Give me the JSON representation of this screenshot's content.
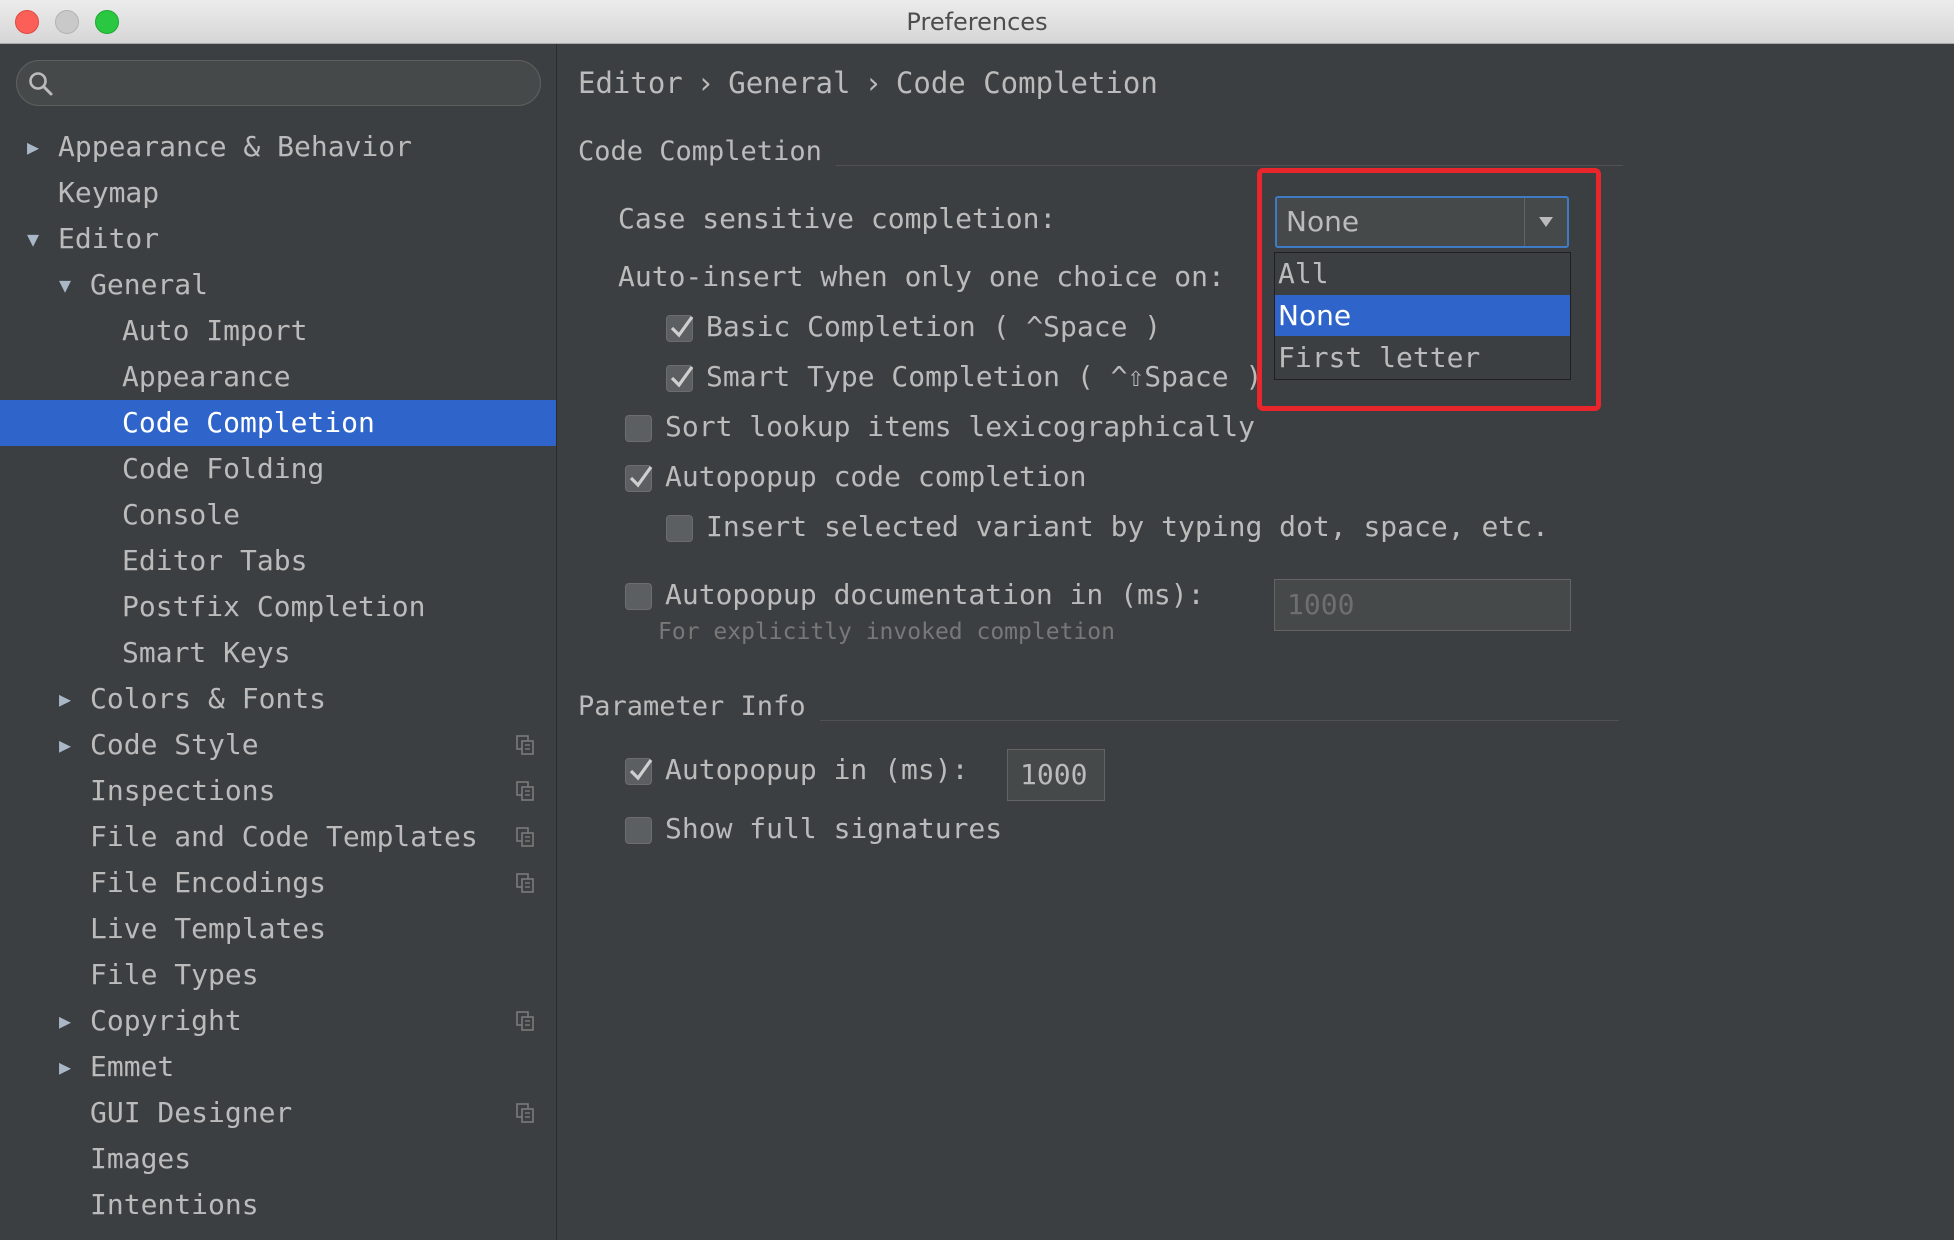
{
  "window": {
    "title": "Preferences"
  },
  "search": {
    "value": "",
    "placeholder": ""
  },
  "sidebar": {
    "items": [
      {
        "label": "Appearance & Behavior",
        "arrow": "▶"
      },
      {
        "label": "Keymap",
        "arrow": ""
      },
      {
        "label": "Editor",
        "arrow": "▼"
      },
      {
        "label": "General",
        "arrow": "▼"
      },
      {
        "label": "Auto Import",
        "arrow": ""
      },
      {
        "label": "Appearance",
        "arrow": ""
      },
      {
        "label": "Code Completion",
        "arrow": ""
      },
      {
        "label": "Code Folding",
        "arrow": ""
      },
      {
        "label": "Console",
        "arrow": ""
      },
      {
        "label": "Editor Tabs",
        "arrow": ""
      },
      {
        "label": "Postfix Completion",
        "arrow": ""
      },
      {
        "label": "Smart Keys",
        "arrow": ""
      },
      {
        "label": "Colors & Fonts",
        "arrow": "▶"
      },
      {
        "label": "Code Style",
        "arrow": "▶"
      },
      {
        "label": "Inspections",
        "arrow": ""
      },
      {
        "label": "File and Code Templates",
        "arrow": ""
      },
      {
        "label": "File Encodings",
        "arrow": ""
      },
      {
        "label": "Live Templates",
        "arrow": ""
      },
      {
        "label": "File Types",
        "arrow": ""
      },
      {
        "label": "Copyright",
        "arrow": "▶"
      },
      {
        "label": "Emmet",
        "arrow": "▶"
      },
      {
        "label": "GUI Designer",
        "arrow": ""
      },
      {
        "label": "Images",
        "arrow": ""
      },
      {
        "label": "Intentions",
        "arrow": ""
      }
    ],
    "selected_item": "Code Completion",
    "project_icon": "copy-icon"
  },
  "breadcrumb": {
    "part1": "Editor",
    "part2": "General",
    "part3": "Code Completion",
    "separator": "›"
  },
  "code_completion": {
    "section_title": "Code Completion",
    "case_label": "Case sensitive completion:",
    "case_value": "None",
    "case_options": [
      "All",
      "None",
      "First letter"
    ],
    "case_selected_option": "None",
    "auto_insert_label": "Auto-insert when only one choice on:",
    "basic_label": "Basic Completion ( ^Space )",
    "basic_checked": true,
    "smart_label": "Smart Type Completion ( ^⇧Space )",
    "smart_checked": true,
    "sort_label": "Sort lookup items lexicographically",
    "sort_checked": false,
    "autopopup_label": "Autopopup code completion",
    "autopopup_checked": true,
    "insert_variant_label": "Insert selected variant by typing dot, space, etc.",
    "insert_variant_checked": false,
    "autopopup_doc_label": "Autopopup documentation in (ms):",
    "autopopup_doc_checked": false,
    "autopopup_doc_value": "1000",
    "autopopup_doc_hint": "For explicitly invoked completion"
  },
  "parameter_info": {
    "section_title": "Parameter Info",
    "autopopup_label": "Autopopup in (ms):",
    "autopopup_checked": true,
    "autopopup_value": "1000",
    "full_sig_label": "Show full signatures",
    "full_sig_checked": false
  },
  "colors": {
    "selection": "#2f65ca",
    "background": "#3c3f41",
    "highlight_box": "#e8262b"
  }
}
